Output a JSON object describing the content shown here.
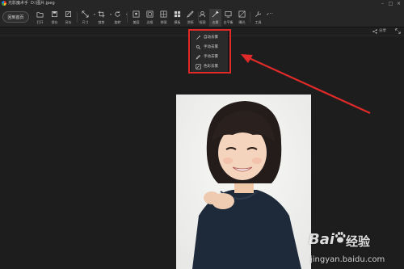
{
  "window": {
    "app_title": "光影魔术手",
    "file_path": "D:\\图片.jpeg"
  },
  "toolbar": {
    "back_label": "回到首页",
    "tools": [
      {
        "label": "打开",
        "icon": "open-icon"
      },
      {
        "label": "保存",
        "icon": "save-icon"
      },
      {
        "label": "另存",
        "icon": "save-as-icon"
      },
      {
        "label": "尺寸",
        "icon": "resize-icon"
      },
      {
        "label": "裁剪",
        "icon": "crop-icon"
      },
      {
        "label": "旋转",
        "icon": "rotate-icon"
      },
      {
        "label": "美容",
        "icon": "beauty-icon"
      },
      {
        "label": "边框",
        "icon": "frame-icon"
      },
      {
        "label": "拼图",
        "icon": "collage-icon"
      },
      {
        "label": "模板",
        "icon": "template-icon"
      },
      {
        "label": "涂鸦",
        "icon": "doodle-icon"
      },
      {
        "label": "抠图",
        "icon": "cutout-icon"
      },
      {
        "label": "去雾",
        "icon": "defog-icon"
      },
      {
        "label": "白平衡",
        "icon": "white-balance-icon"
      },
      {
        "label": "曝光",
        "icon": "exposure-icon"
      },
      {
        "label": "工具",
        "icon": "tools-icon"
      }
    ]
  },
  "subbar": {
    "share_label": "分享"
  },
  "dropdown": {
    "items": [
      {
        "label": "自动去雾",
        "icon": "magic-wand-icon"
      },
      {
        "label": "手动去雾",
        "icon": "brush-icon"
      },
      {
        "label": "手动去雾",
        "icon": "pen-icon"
      },
      {
        "label": "色彩去雾",
        "icon": "color-icon"
      }
    ]
  },
  "annotation": {
    "highlight_color": "#e02a2a"
  },
  "watermark": {
    "brand": "Bai",
    "brand_sub": "经验",
    "url": "jingyan.baidu.com"
  }
}
